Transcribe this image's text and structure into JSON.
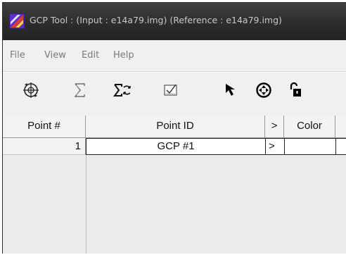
{
  "window": {
    "title": "GCP Tool : (Input : e14a79.img) (Reference : e14a79.img)"
  },
  "menu": {
    "items": [
      "File",
      "View",
      "Edit",
      "Help"
    ]
  },
  "toolbar": {
    "tools": [
      {
        "name": "gcp-reference-setup-icon",
        "glyph": "⊛"
      },
      {
        "name": "sigma-icon",
        "glyph": "Σ"
      },
      {
        "name": "sigma-compute-icon",
        "glyph": "Σ"
      },
      {
        "name": "checkbox-check-icon",
        "glyph": "☑"
      },
      {
        "name": "pointer-arrow-icon",
        "glyph": "↖"
      },
      {
        "name": "crosshair-icon",
        "glyph": "⊕"
      },
      {
        "name": "unlock-icon",
        "glyph": "🔓"
      }
    ]
  },
  "table": {
    "headers": {
      "point_num": "Point #",
      "point_id": "Point ID",
      "arrow": ">",
      "color": "Color"
    },
    "rows": [
      {
        "num": "1",
        "id": "GCP #1",
        "arrow": ">",
        "color": ""
      }
    ]
  },
  "colors": {
    "titlebar": "#2b2b2b",
    "title_text": "#c8c8c8",
    "menu_text": "#7a7a7a"
  }
}
